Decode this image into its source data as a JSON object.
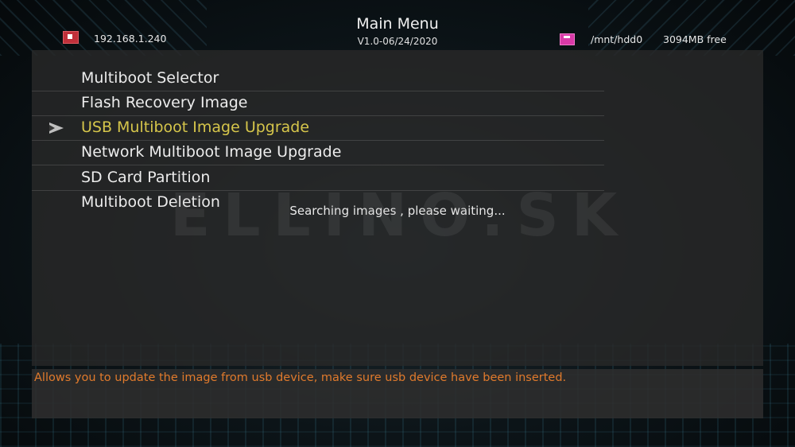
{
  "header": {
    "title": "Main Menu",
    "version": "V1.0-06/24/2020",
    "ip_address": "192.168.1.240",
    "storage_path": "/mnt/hdd0",
    "storage_free": "3094MB free",
    "network_icon": "network-status-icon",
    "storage_icon": "hdd-icon"
  },
  "watermark": "ELLINO.SK",
  "menu": {
    "selected_index": 2,
    "items": [
      {
        "label": "Multiboot Selector"
      },
      {
        "label": "Flash Recovery Image"
      },
      {
        "label": "USB Multiboot Image Upgrade"
      },
      {
        "label": "Network Multiboot Image Upgrade"
      },
      {
        "label": "SD Card Partition"
      },
      {
        "label": "Multiboot Deletion"
      }
    ]
  },
  "status": "Searching images , please waiting...",
  "description": "Allows you to update the image from usb device, make sure usb device have been inserted.",
  "colors": {
    "selected_text": "#d6c64b",
    "description_text": "#e07a2c",
    "network_icon": "#c0303a",
    "hdd_icon": "#d93aa8"
  }
}
